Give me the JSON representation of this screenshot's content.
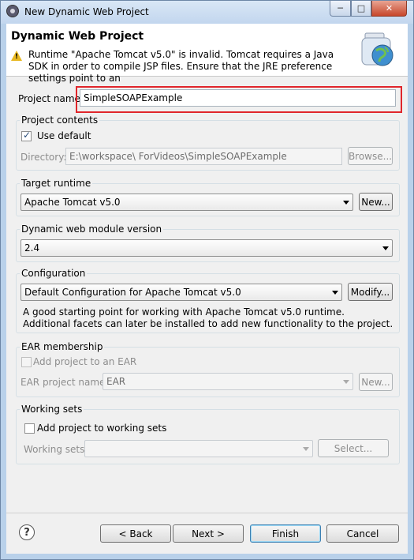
{
  "window": {
    "title": "New Dynamic Web Project",
    "minimize_icon": "minimize-icon",
    "maximize_icon": "maximize-icon",
    "close_icon": "close-icon"
  },
  "header": {
    "title": "Dynamic Web Project",
    "message": "Runtime \"Apache Tomcat v5.0\" is invalid. Tomcat requires a Java SDK in order to compile JSP files. Ensure that the JRE preference settings point to an",
    "warning_icon": "warning-icon",
    "image_icon": "globe-jar-icon"
  },
  "project_name": {
    "label": "Project name:",
    "value": "SimpleSOAPExample"
  },
  "project_contents": {
    "group_label": "Project contents",
    "use_default_label": "Use default",
    "use_default_checked": true,
    "directory_label": "Directory:",
    "directory_value": "E:\\workspace\\ ForVideos\\SimpleSOAPExample",
    "browse_label": "Browse..."
  },
  "target_runtime": {
    "group_label": "Target runtime",
    "selected": "Apache Tomcat v5.0",
    "new_label": "New..."
  },
  "web_module": {
    "group_label": "Dynamic web module version",
    "selected": "2.4"
  },
  "configuration": {
    "group_label": "Configuration",
    "selected": "Default Configuration for Apache Tomcat v5.0",
    "modify_label": "Modify...",
    "description": "A good starting point for working with Apache Tomcat v5.0 runtime. Additional facets can later be installed to add new functionality to the project."
  },
  "ear": {
    "group_label": "EAR membership",
    "add_label": "Add project to an EAR",
    "add_checked": false,
    "name_label": "EAR project name:",
    "name_value": "EAR",
    "new_label": "New..."
  },
  "working_sets": {
    "group_label": "Working sets",
    "add_label": "Add project to working sets",
    "add_checked": false,
    "sets_label": "Working sets:",
    "sets_value": "",
    "select_label": "Select..."
  },
  "footer": {
    "help_icon": "help-icon",
    "help_glyph": "?",
    "back_label": "< Back",
    "next_label": "Next >",
    "finish_label": "Finish",
    "cancel_label": "Cancel"
  }
}
